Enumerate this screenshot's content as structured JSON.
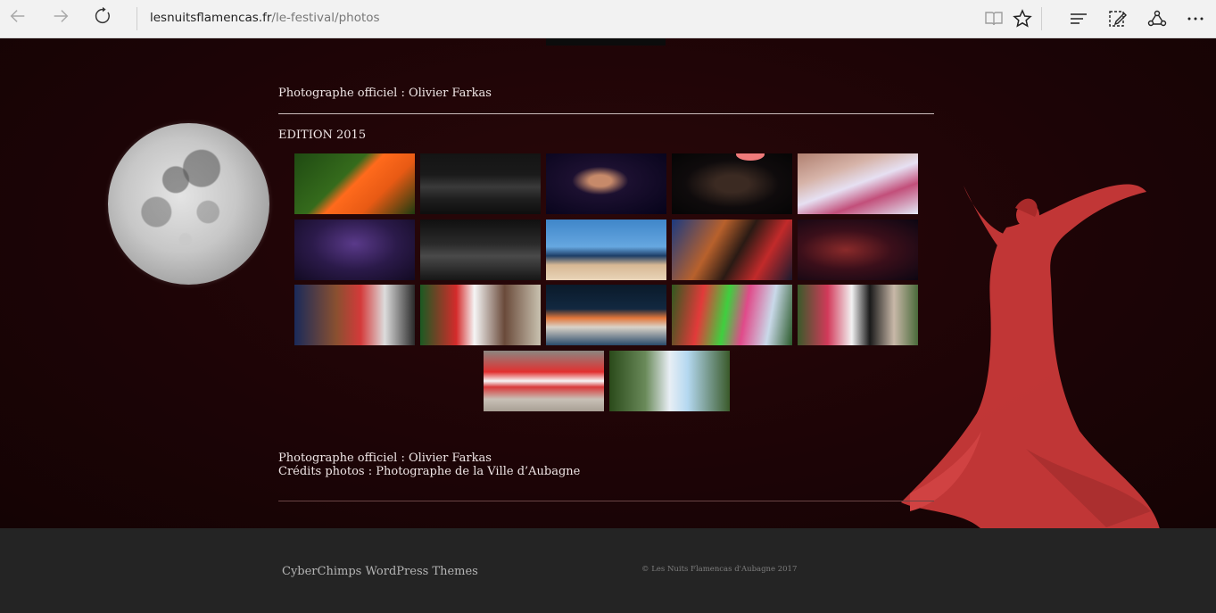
{
  "browser": {
    "url_domain": "lesnuitsflamencas.fr",
    "url_path": "/le-festival/photos",
    "icons": [
      "back-arrow-icon",
      "forward-arrow-icon",
      "refresh-icon",
      "reading-view-icon",
      "favorite-star-icon",
      "hub-icon",
      "web-note-icon",
      "share-icon",
      "more-icon"
    ]
  },
  "page": {
    "photographer_top": "Photographe officiel : Olivier Farkas",
    "edition_heading": "EDITION 2015",
    "photographer_bottom": "Photographe officiel : Olivier Farkas",
    "credits": "Crédits photos : Photographe de la Ville d’Aubagne"
  },
  "gallery": [
    {
      "desc": "dancer-orange-dress"
    },
    {
      "desc": "choir-stage"
    },
    {
      "desc": "singer-dark-stage"
    },
    {
      "desc": "guitarist-dark-stage"
    },
    {
      "desc": "children-craft-table"
    },
    {
      "desc": "dancers-purple-stage"
    },
    {
      "desc": "group-stage-guitars"
    },
    {
      "desc": "dancers-blue-polka"
    },
    {
      "desc": "musicians-red-stage"
    },
    {
      "desc": "performers-dark-stage"
    },
    {
      "desc": "pianist-korg"
    },
    {
      "desc": "red-polka-dresses"
    },
    {
      "desc": "dance-show-evening"
    },
    {
      "desc": "colorful-dancers-park"
    },
    {
      "desc": "crowd-dancing-outdoor"
    },
    {
      "desc": "red-ruffle-skirts"
    },
    {
      "desc": "kids-outdoor-table"
    }
  ],
  "footer": {
    "theme_link": "CyberChimps WordPress Themes",
    "copyright": "© Les Nuits Flamencas d'Aubagne 2017"
  },
  "colors": {
    "page_bg": "#1b0406",
    "footer_bg": "#242424",
    "dancer_red": "#d9403f"
  }
}
